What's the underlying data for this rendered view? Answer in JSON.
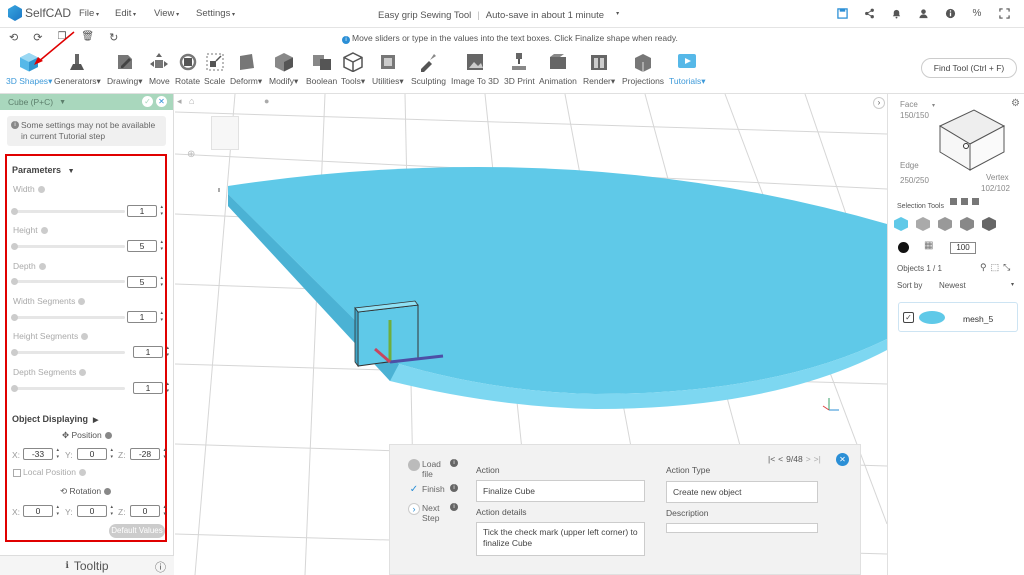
{
  "app": {
    "logo": "SelfCAD"
  },
  "menu": [
    {
      "label": "File"
    },
    {
      "label": "Edit"
    },
    {
      "label": "View"
    },
    {
      "label": "Settings"
    }
  ],
  "title": {
    "project": "Easy grip Sewing Tool",
    "autosave": "Auto-save in about 1 minute"
  },
  "hint": "Move sliders or type in the values into the text boxes. Click Finalize shape when ready.",
  "toolbar": {
    "tools": [
      {
        "label": "3D Shapes",
        "icon": "cube-icon"
      },
      {
        "label": "Generators",
        "icon": "generator-icon"
      },
      {
        "label": "Drawing",
        "icon": "drawing-icon"
      },
      {
        "label": "Move",
        "icon": "move-icon"
      },
      {
        "label": "Rotate",
        "icon": "rotate-icon"
      },
      {
        "label": "Scale",
        "icon": "scale-icon"
      },
      {
        "label": "Deform",
        "icon": "deform-icon"
      },
      {
        "label": "Modify",
        "icon": "modify-icon"
      },
      {
        "label": "Boolean",
        "icon": "boolean-icon"
      },
      {
        "label": "Tools",
        "icon": "tools-icon"
      },
      {
        "label": "Utilities",
        "icon": "utilities-icon"
      },
      {
        "label": "Sculpting",
        "icon": "sculpting-icon"
      },
      {
        "label": "Image To 3D",
        "icon": "image-to-3d-icon"
      },
      {
        "label": "3D Print",
        "icon": "3d-print-icon"
      },
      {
        "label": "Animation",
        "icon": "animation-icon"
      },
      {
        "label": "Render",
        "icon": "render-icon"
      },
      {
        "label": "Projections",
        "icon": "projections-icon"
      },
      {
        "label": "Tutorials",
        "icon": "tutorials-icon"
      }
    ],
    "find": "Find Tool (Ctrl + F)"
  },
  "panel": {
    "header": "Cube (P+C)",
    "warning": "Some settings may not be available in current Tutorial step",
    "parameters_label": "Parameters",
    "params": [
      {
        "label": "Width",
        "value": "1"
      },
      {
        "label": "Height",
        "value": "5"
      },
      {
        "label": "Depth",
        "value": "5"
      },
      {
        "label": "Width Segments",
        "value": "1"
      },
      {
        "label": "Height Segments",
        "value": "1"
      },
      {
        "label": "Depth Segments",
        "value": "1"
      }
    ],
    "object_displaying": "Object Displaying",
    "position_label": "Position",
    "position": {
      "x": "-33",
      "y": "0",
      "z": "-28"
    },
    "local_position": "Local Position",
    "rotation_label": "Rotation",
    "rotation": {
      "x": "0",
      "y": "0",
      "z": "0"
    },
    "axis": {
      "x": "X:",
      "y": "Y:",
      "z": "Z:"
    },
    "default_values": "Default Values",
    "tooltip": "Tooltip"
  },
  "right": {
    "face_label": "Face",
    "face_count": "150/150",
    "edge_label": "Edge",
    "edge_count": "250/250",
    "vertex_label": "Vertex",
    "vertex_count": "102/102",
    "selection_tools": "Selection Tools",
    "opacity": "100",
    "objects": "Objects 1 / 1",
    "sort_by": "Sort by",
    "sort_value": "Newest",
    "object_name": "mesh_5"
  },
  "action_panel": {
    "steps": [
      {
        "label": "Load file"
      },
      {
        "label": "Finish"
      },
      {
        "label": "Next Step"
      }
    ],
    "action_label": "Action",
    "action_value": "Finalize Cube",
    "details_label": "Action details",
    "details_value": "Tick the check mark (upper left corner) to finalize Cube",
    "type_label": "Action Type",
    "type_value": "Create new object",
    "description_label": "Description",
    "description_value": "",
    "pager": "9/48"
  },
  "colors": {
    "accent": "#3e9ad9",
    "mesh": "#5fc9e8",
    "highlight": "#e00000",
    "panel_header": "#a9d7bd"
  }
}
